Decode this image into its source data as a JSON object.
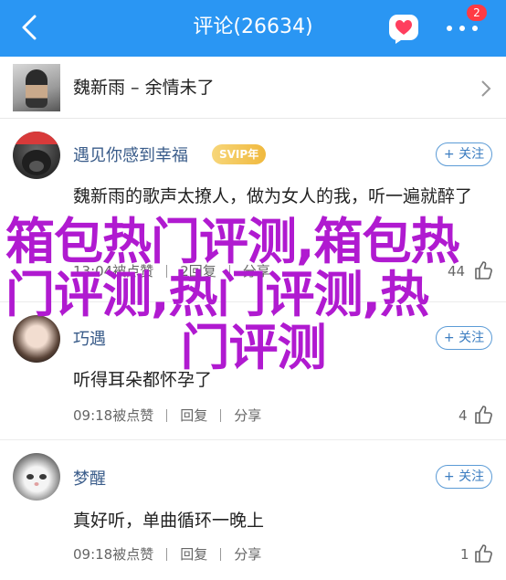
{
  "header": {
    "title": "评论(26634)",
    "badge_count": "2"
  },
  "song": {
    "title": "魏新雨 – 余情未了"
  },
  "comments": [
    {
      "name": "遇见你感到幸福",
      "vip_badge": "SVIP年",
      "follow_label": "+ 关注",
      "text": "魏新雨的歌声太撩人，做为女人的我，听一遍就醉了",
      "time": "13:04被点赞",
      "reply": "2回复",
      "share": "分享",
      "likes": "44"
    },
    {
      "name": "巧遇",
      "follow_label": "+ 关注",
      "text": "听得耳朵都怀孕了",
      "time": "09:18被点赞",
      "reply": "回复",
      "share": "分享",
      "likes": "4"
    },
    {
      "name": "梦醒",
      "follow_label": "+ 关注",
      "text": "真好听，单曲循环一晚上",
      "time": "09:18被点赞",
      "reply": "回复",
      "share": "分享",
      "likes": "1"
    }
  ],
  "watermark": {
    "line1": "箱包热门评测,箱包热",
    "line2": "门评测,热门评测,热",
    "line3": "门评测"
  },
  "colors": {
    "header_bg": "#2a96f3",
    "name_color": "#3a5c8a",
    "watermark": "#b01ad0",
    "badge": "#ff3b44"
  }
}
